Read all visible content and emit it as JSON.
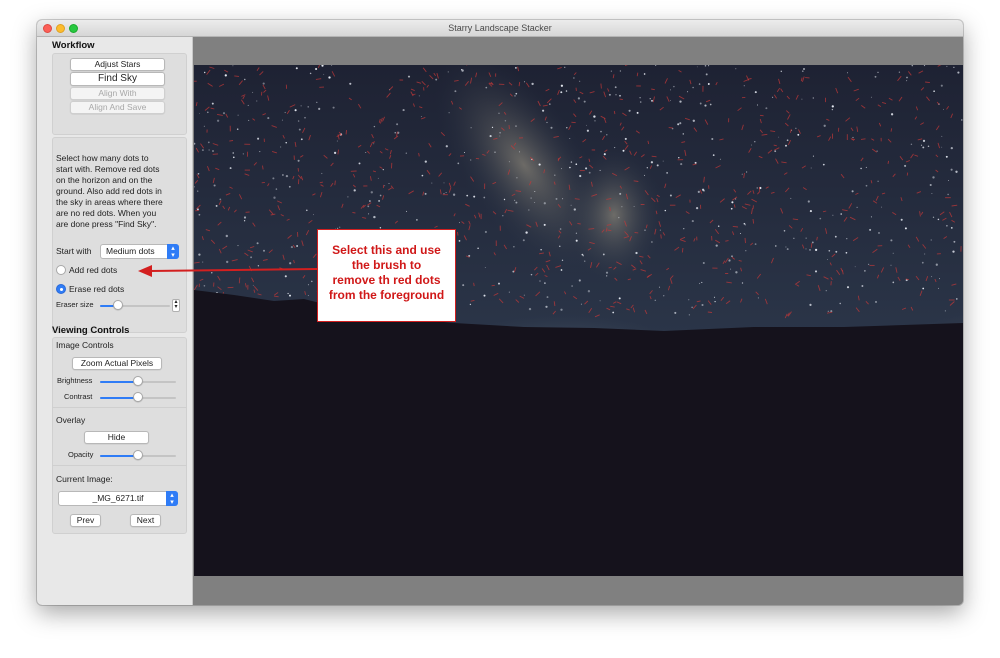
{
  "window": {
    "title": "Starry Landscape Stacker"
  },
  "workflow": {
    "heading": "Workflow",
    "buttons": {
      "adjust_stars": "Adjust Stars",
      "find_sky": "Find Sky",
      "align_with": "Align With",
      "align_and_save": "Align And Save"
    },
    "instructions": [
      "Select how many dots to",
      "start with. Remove red dots",
      "on the horizon and on the",
      "ground. Also add red dots in",
      "the sky in areas where there",
      "are no red dots. When you",
      "are done press \"Find Sky\"."
    ],
    "start_with_label": "Start with",
    "start_with_value": "Medium dots",
    "add_red_dots": "Add red dots",
    "erase_red_dots": "Erase red dots",
    "selected_mode": "Erase red dots",
    "eraser_size_label": "Eraser size",
    "eraser_size_level": 0.25
  },
  "viewing": {
    "heading": "Viewing Controls",
    "image_controls": "Image Controls",
    "zoom_button": "Zoom Actual Pixels",
    "brightness_label": "Brightness",
    "brightness_level": 0.5,
    "contrast_label": "Contrast",
    "contrast_level": 0.5,
    "overlay_label": "Overlay",
    "hide_button": "Hide",
    "opacity_label": "Opacity",
    "opacity_level": 0.5,
    "current_image_label": "Current Image:",
    "current_image_value": "_MG_6271.tif",
    "prev_button": "Prev",
    "next_button": "Next"
  },
  "annotation": {
    "lines": [
      "Select this and use",
      "the brush to",
      "remove th red dots",
      "from the foreground"
    ]
  },
  "colors": {
    "accent": "#2f7cf6",
    "annotation_red": "#d31f1f",
    "sky_top": "#22283a",
    "ground": "#15121c"
  }
}
